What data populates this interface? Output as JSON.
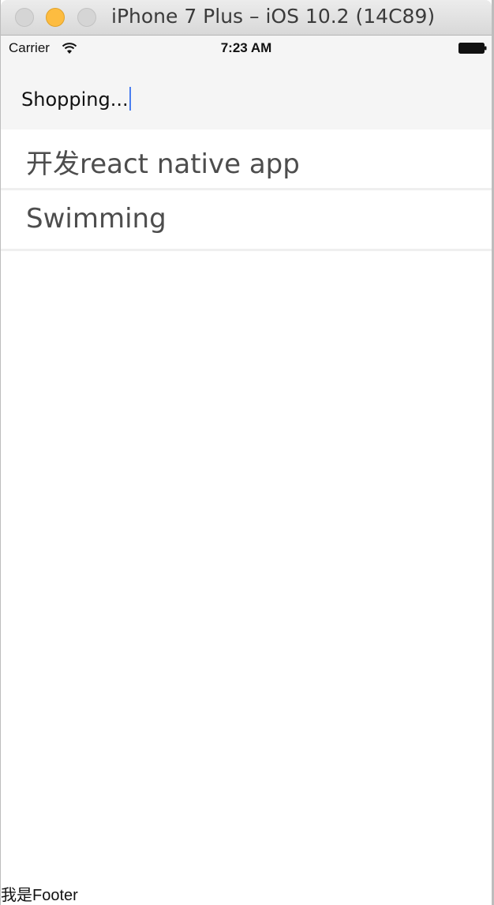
{
  "window": {
    "title": "iPhone 7 Plus – iOS 10.2 (14C89)"
  },
  "status_bar": {
    "carrier": "Carrier",
    "time": "7:23 AM",
    "icons": [
      "wifi-icon",
      "battery-icon"
    ]
  },
  "header": {
    "input_value": "Shopping..."
  },
  "todos": [
    {
      "label": "开发react native app"
    },
    {
      "label": "Swimming"
    }
  ],
  "footer": {
    "text": "我是Footer"
  },
  "colors": {
    "caret": "#4a7ef0",
    "header_bg": "#f5f5f5",
    "traffic_minimize": "#fdbc40"
  }
}
